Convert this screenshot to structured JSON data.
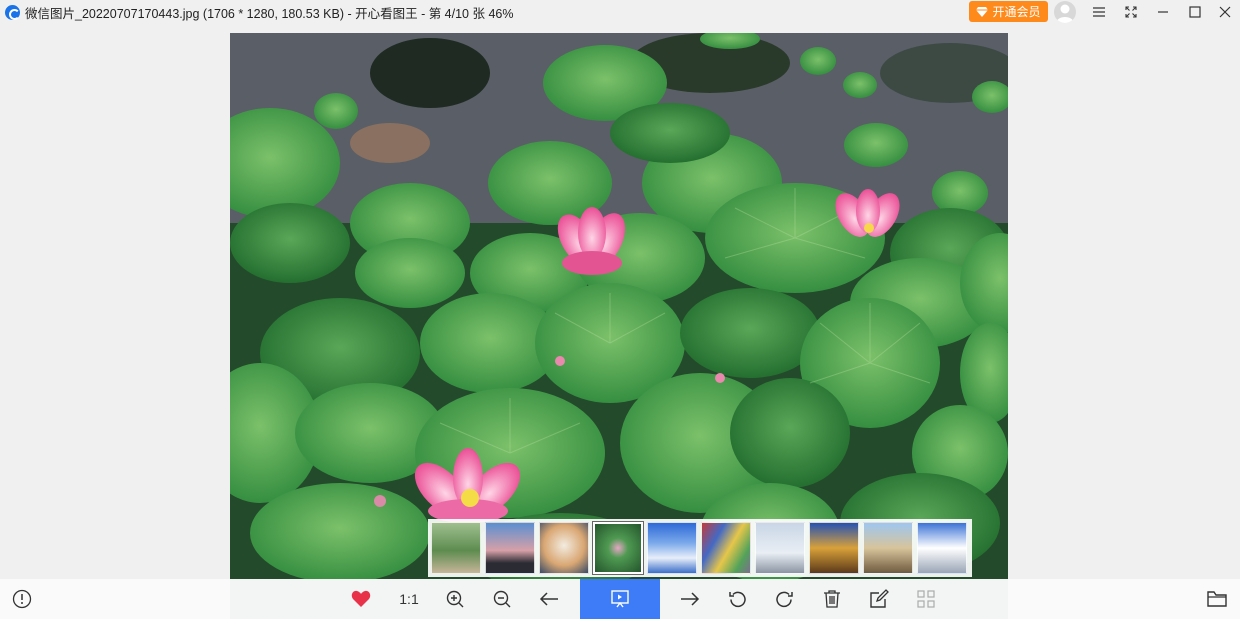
{
  "window": {
    "title": "微信图片_20220707170443.jpg (1706 * 1280, 180.53 KB) - 开心看图王 - 第 4/10 张 46%"
  },
  "header": {
    "vip_label": "开通会员"
  },
  "toolbar": {
    "ratio_label": "1:1"
  },
  "thumbnails": [
    {
      "name": "garden-path"
    },
    {
      "name": "sunset-sky"
    },
    {
      "name": "cat"
    },
    {
      "name": "lotus-pond",
      "active": true
    },
    {
      "name": "blue-sky-clouds"
    },
    {
      "name": "colorful-wall"
    },
    {
      "name": "winter-trees"
    },
    {
      "name": "golden-trees"
    },
    {
      "name": "building-trees"
    },
    {
      "name": "cloudy-sky"
    }
  ],
  "colors": {
    "accent": "#3d7cf6",
    "vip": "#ff8a1c",
    "favorite": "#e8324a"
  }
}
